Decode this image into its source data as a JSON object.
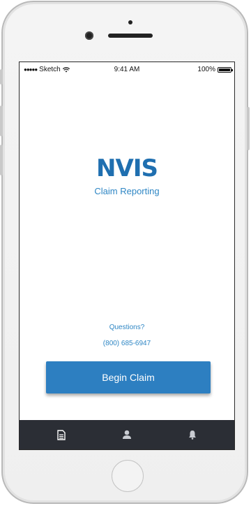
{
  "status_bar": {
    "signal": "●●●●●",
    "carrier": "Sketch",
    "time": "9:41 AM",
    "battery": "100%"
  },
  "brand": {
    "logo_text": "NVIS",
    "subtitle": "Claim Reporting",
    "color": "#1f6fb0"
  },
  "contact": {
    "questions_label": "Questions?",
    "phone": "(800) 685-6947"
  },
  "actions": {
    "begin_claim_label": "Begin Claim",
    "button_color": "#2d7fc1"
  },
  "tab_bar": {
    "background": "#2b2e35",
    "items": [
      {
        "icon": "document-icon"
      },
      {
        "icon": "profile-icon"
      },
      {
        "icon": "bell-icon"
      }
    ]
  }
}
